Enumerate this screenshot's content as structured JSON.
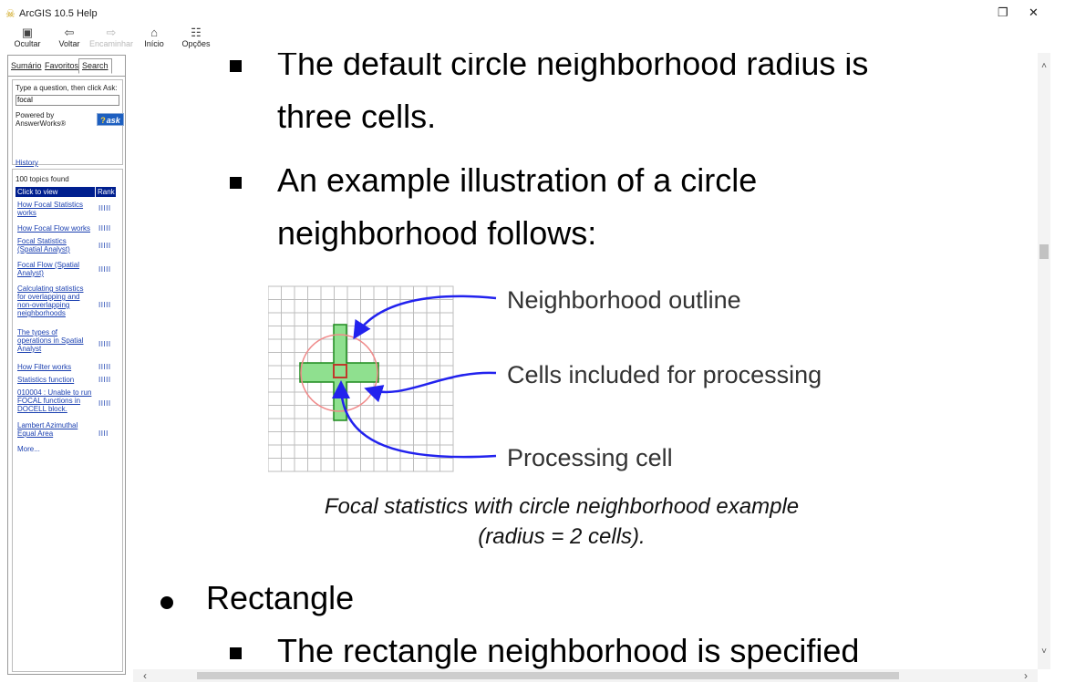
{
  "window": {
    "title": "ArcGIS 10.5 Help",
    "restore_glyph": "❐",
    "close_glyph": "✕"
  },
  "toolbar": {
    "buttons": [
      {
        "label": "Ocultar",
        "icon": "▣",
        "icon_name": "hide-pane-icon",
        "enabled": true
      },
      {
        "label": "Voltar",
        "icon": "⇦",
        "icon_name": "back-arrow-icon",
        "enabled": true
      },
      {
        "label": "Encaminhar",
        "icon": "⇨",
        "icon_name": "forward-arrow-icon",
        "enabled": false
      },
      {
        "label": "Início",
        "icon": "⌂",
        "icon_name": "home-icon",
        "enabled": true
      },
      {
        "label": "Opções",
        "icon": "☷",
        "icon_name": "options-icon",
        "enabled": true
      }
    ]
  },
  "navigation": {
    "tabs": [
      {
        "label": "Sumário",
        "active": false
      },
      {
        "label": "Favoritos",
        "active": false
      },
      {
        "label": "Search",
        "active": true
      }
    ],
    "ask": {
      "prompt": "Type a question, then click Ask:",
      "query": "focal",
      "powered_by": "Powered by AnswerWorks®",
      "ask_button_label": "ask",
      "history_label": "History"
    },
    "results": {
      "count_text": "100 topics found",
      "header_topic": "Click to view",
      "header_rank": "Rank",
      "items": [
        {
          "title": "How Focal Statistics works",
          "rank": "IIIII"
        },
        {
          "title": "How Focal Flow works",
          "rank": "IIIII"
        },
        {
          "title": "Focal Statistics (Spatial Analyst)",
          "rank": "IIIII"
        },
        {
          "title": "Focal Flow (Spatial Analyst)",
          "rank": "IIIII"
        },
        {
          "title": "Calculating statistics for overlapping and non-overlapping neighborhoods",
          "rank": "IIIII"
        },
        {
          "title": "The types of operations in Spatial Analyst",
          "rank": "IIIII"
        },
        {
          "title": "How Filter works",
          "rank": "IIIII"
        },
        {
          "title": "Statistics function",
          "rank": "IIIII"
        },
        {
          "title": "010004 : Unable to run FOCAL functions in DOCELL block.",
          "rank": "IIIII"
        },
        {
          "title": "Lambert Azimuthal Equal Area",
          "rank": "IIII"
        }
      ],
      "more_label": "More..."
    }
  },
  "content": {
    "lines": [
      "The default circle neighborhood radius is",
      "three cells.",
      "An example illustration of a circle",
      "neighborhood follows:"
    ],
    "figure": {
      "labels": {
        "outline": "Neighborhood outline",
        "included": "Cells included for processing",
        "processing": "Processing cell"
      },
      "colors": {
        "grid": "#bdbdbd",
        "included_fill": "#8fe08f",
        "included_stroke": "#1d8a1d",
        "circle": "#f08a8a",
        "processing_cell": "#c0392b",
        "arrows": "#2222ee"
      },
      "caption_line1": "Focal statistics with circle neighborhood example",
      "caption_line2": "(radius = 2 cells)."
    },
    "section_heading": "Rectangle",
    "section_line": "The rectangle neighborhood is specified"
  },
  "scrollbars": {
    "up": "˄",
    "down": "˅",
    "left": "‹",
    "right": "›"
  }
}
